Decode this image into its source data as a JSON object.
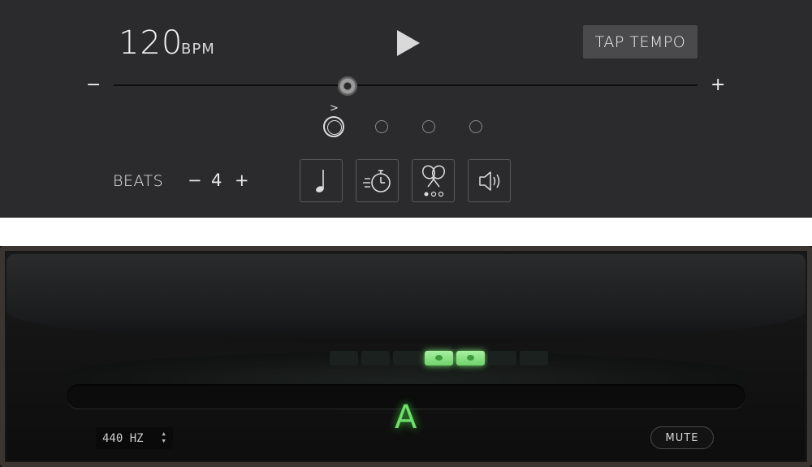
{
  "metronome": {
    "bpm_value": "120",
    "bpm_unit": "BPM",
    "tap_label": "TAP TEMPO",
    "tempo_slider": {
      "min_label": "−",
      "max_label": "+"
    },
    "accent_mark": ">",
    "beats": {
      "label": "BEATS",
      "minus": "−",
      "count": "4",
      "plus": "+"
    },
    "beat_indicators": [
      {
        "state": "accented-active"
      },
      {
        "state": "off"
      },
      {
        "state": "off"
      },
      {
        "state": "off"
      }
    ],
    "tools": [
      {
        "icon": "quarter-note-icon"
      },
      {
        "icon": "stopwatch-icon"
      },
      {
        "icon": "maracas-icon"
      },
      {
        "icon": "speaker-icon"
      }
    ]
  },
  "tuner": {
    "note": "A",
    "reference": "440 HZ",
    "mute_label": "MUTE",
    "colors": {
      "lit": "#6fe06a",
      "frame": "#3a3530"
    }
  }
}
